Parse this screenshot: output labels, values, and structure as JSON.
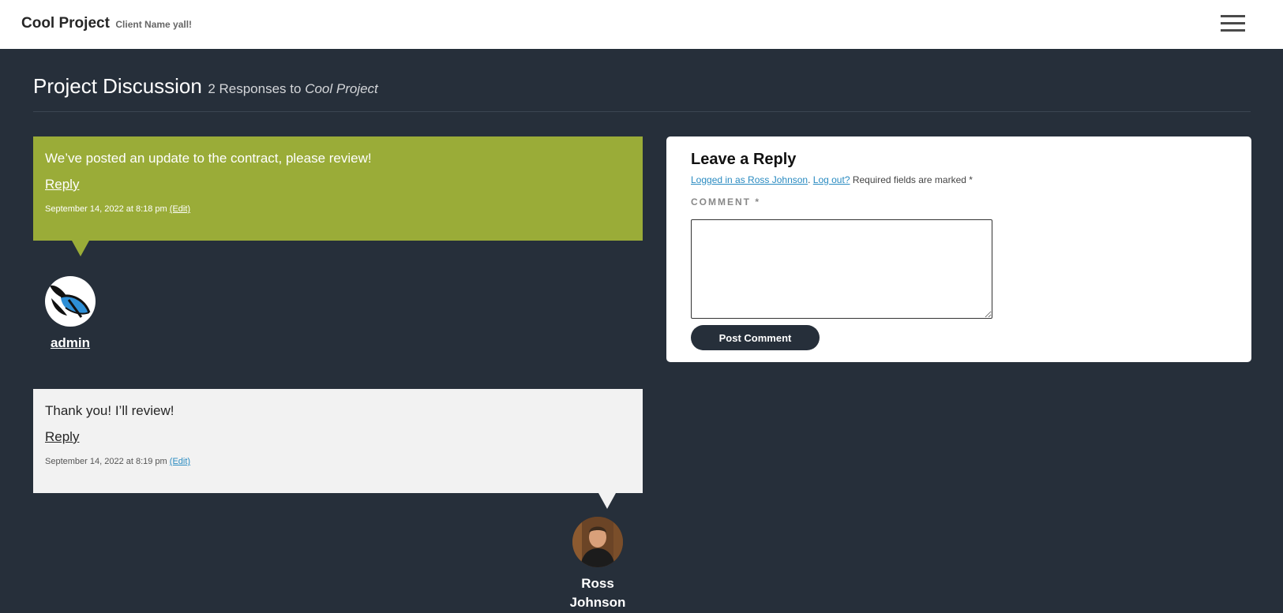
{
  "header": {
    "title": "Cool Project",
    "subtitle": "Client Name yall!",
    "menu_icon": "hamburger-icon"
  },
  "page": {
    "title": "Project Discussion",
    "responses_prefix": "2 Responses to",
    "project_name": "Cool Project"
  },
  "comments": [
    {
      "text": "We’ve posted an update to the contract, please review!",
      "reply_label": "Reply",
      "date": "September 14, 2022 at 8:18 pm",
      "edit_label": "(Edit)",
      "author": "admin",
      "bubble_color": "#9aac38"
    },
    {
      "text": "Thank you! I’ll review!",
      "reply_label": "Reply",
      "date": "September 14, 2022 at 8:19 pm",
      "edit_label": "(Edit)",
      "author_first": "Ross",
      "author_last": "Johnson",
      "bubble_color": "#f2f2f2"
    }
  ],
  "reply_form": {
    "title": "Leave a Reply",
    "logged_in_link": "Logged in as Ross Johnson",
    "logout_link": "Log out?",
    "required_note": "Required fields are marked *",
    "comment_label": "COMMENT *",
    "comment_value": "",
    "submit_label": "Post Comment"
  },
  "colors": {
    "background": "#262f3a",
    "accent_green": "#9aac38",
    "link_blue": "#2a8bc1"
  }
}
